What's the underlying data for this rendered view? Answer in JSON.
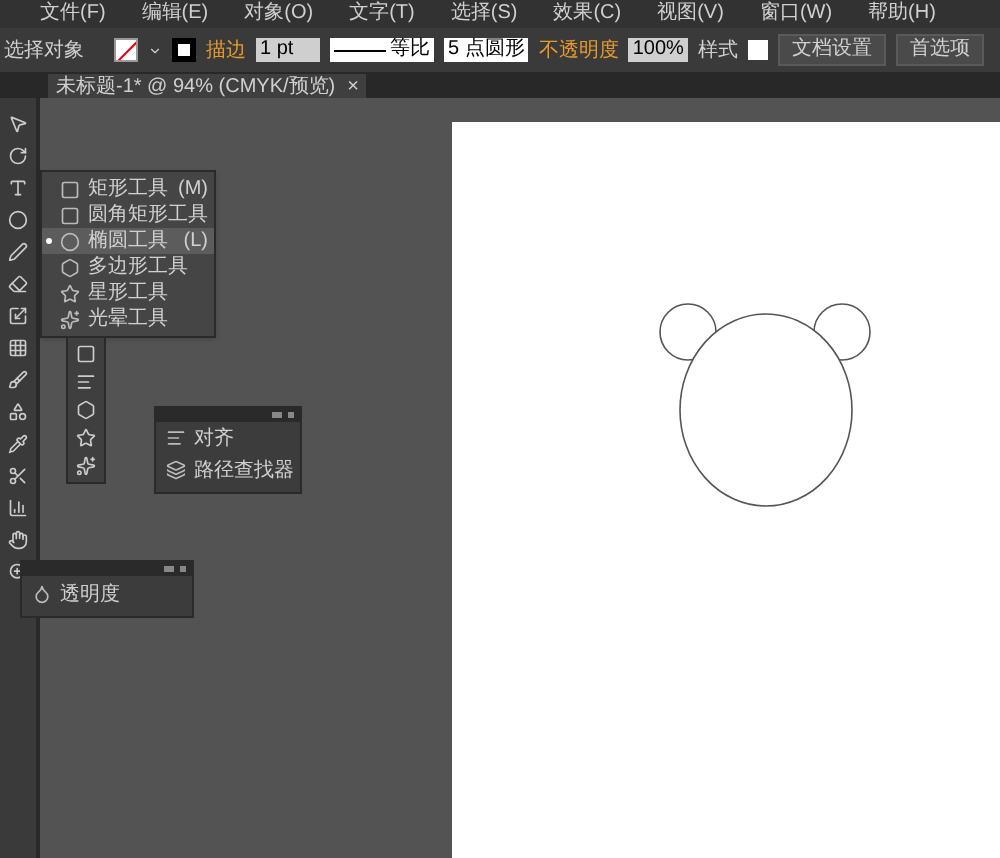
{
  "menu_bar": [
    "文件(F)",
    "编辑(E)",
    "对象(O)",
    "文字(T)",
    "选择(S)",
    "效果(C)",
    "视图(V)",
    "窗口(W)",
    "帮助(H)"
  ],
  "control_bar": {
    "selection_label": "选择对象",
    "stroke_label": "描边",
    "stroke_weight": "1 pt",
    "stroke_profile": "等比",
    "brush": "5 点圆形",
    "opacity_label": "不透明度",
    "opacity": "100%",
    "style_label": "样式",
    "buttons": [
      "文档设置",
      "首选项"
    ]
  },
  "document_tab": {
    "title": "未标题-1* @ 94% (CMYK/预览)",
    "close": "×"
  },
  "tool_flyout": [
    {
      "kind": "rectangle",
      "label": "矩形工具",
      "shortcut": "(M)",
      "selected": false
    },
    {
      "kind": "rounded-rectangle",
      "label": "圆角矩形工具",
      "selected": false
    },
    {
      "kind": "ellipse",
      "label": "椭圆工具",
      "shortcut": "(L)",
      "selected": true
    },
    {
      "kind": "polygon",
      "label": "多边形工具",
      "selected": false
    },
    {
      "kind": "star",
      "label": "星形工具",
      "selected": false
    },
    {
      "kind": "flare",
      "label": "光晕工具",
      "selected": false
    }
  ],
  "align_panel": {
    "items": [
      {
        "kind": "align",
        "label": "对齐"
      },
      {
        "kind": "pathfinder",
        "label": "路径查找器"
      }
    ]
  },
  "transparency_panel": {
    "items": [
      {
        "kind": "transparency",
        "label": "透明度"
      }
    ]
  }
}
